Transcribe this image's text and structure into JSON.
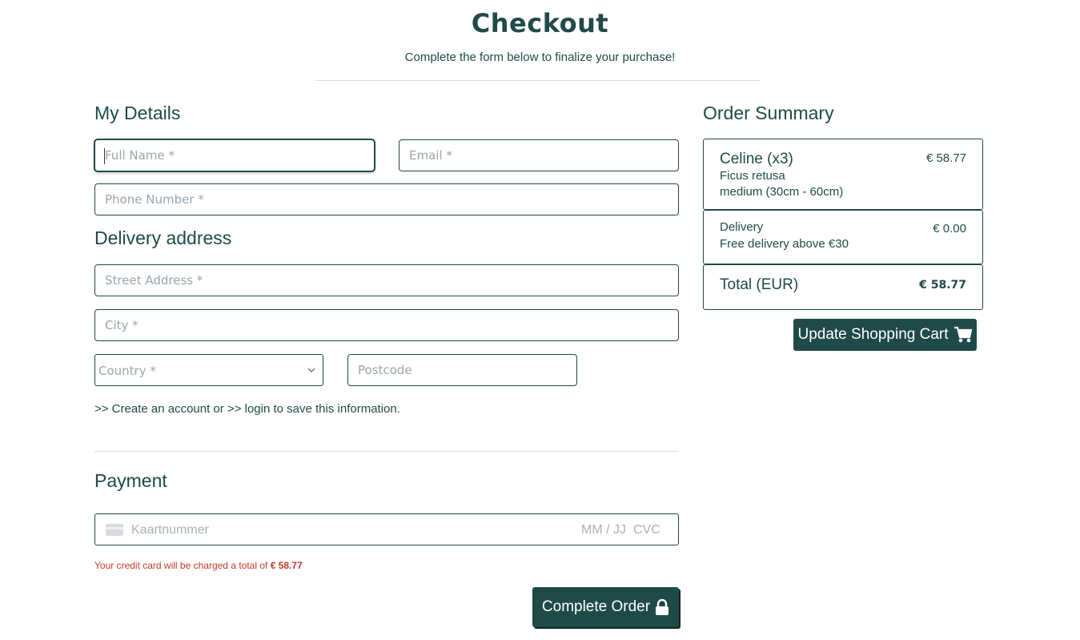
{
  "header": {
    "title": "Checkout",
    "subtitle": "Complete the form below to finalize your purchase!"
  },
  "details": {
    "heading": "My Details",
    "full_name_placeholder": "Full Name *",
    "email_placeholder": "Email *",
    "phone_placeholder": "Phone Number *"
  },
  "delivery_address": {
    "heading": "Delivery address",
    "street_placeholder": "Street Address *",
    "city_placeholder": "City *",
    "country_selected": "Country *",
    "postcode_placeholder": "Postcode"
  },
  "account_note": {
    "prefix": ">> Create an account or >> login to save this information."
  },
  "payment": {
    "heading": "Payment",
    "card_number_placeholder": "Kaartnummer",
    "expiry_placeholder": "MM / JJ",
    "cvc_placeholder": "CVC",
    "charge_text": "Your credit card will be charged a total of",
    "charge_amount": "€ 58.77"
  },
  "buttons": {
    "complete_order": "Complete Order",
    "update_cart": "Update Shopping Cart"
  },
  "order_summary": {
    "heading": "Order Summary",
    "item": {
      "name": "Celine (x3)",
      "price": "€ 58.77",
      "species": "Ficus retusa",
      "size": "medium (30cm - 60cm)"
    },
    "delivery": {
      "label": "Delivery",
      "price": "€ 0.00",
      "note": "Free delivery above €30"
    },
    "total": {
      "label": "Total (EUR)",
      "amount": "€ 58.77"
    }
  },
  "icons": {
    "lock": "lock-icon",
    "cart": "shopping-cart-icon",
    "card": "credit-card-icon",
    "chevron": "chevron-down-icon"
  },
  "colors": {
    "brand": "#1f4a47",
    "error": "#c0392b",
    "placeholder": "#9aa5ae"
  }
}
